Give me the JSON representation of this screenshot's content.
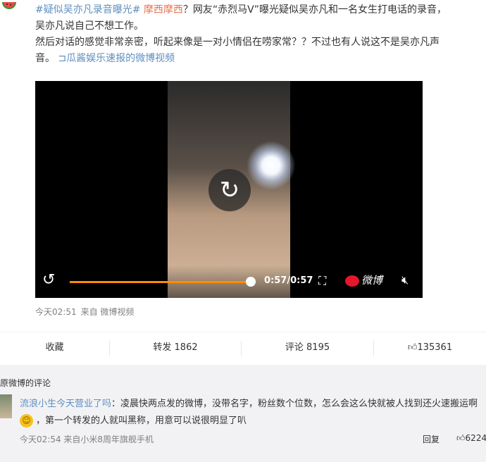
{
  "post": {
    "line1_hashtag": "#疑似吴亦凡录音曝光#",
    "line1_user": "摩西摩西",
    "line1_rest": "？网友“赤烈马V”曝光疑似吴亦凡和一名女生打电话的录音，",
    "line2": "吴亦凡说自己不想工作。",
    "line3": "然后对话的感觉非常亲密，听起来像是一对小情侣在唠家常？？不过也有人说这不是吴亦凡声",
    "line4_start": "音。",
    "line4_link": "瓜酱娱乐速报的微博视频"
  },
  "video": {
    "time": "0:57/0:57",
    "brand": "微博",
    "progress": 1.0
  },
  "meta": {
    "time": "今天02:51",
    "source": "来自 微博视频"
  },
  "actions": {
    "favorite": "收藏",
    "repost": "转发 1862",
    "comment": "评论 8195",
    "like": "135361"
  },
  "comments": {
    "title": "原微博的评论",
    "items": [
      {
        "user": "流浪小生今天营业了吗",
        "text1": "：凌晨快两点发的微博，没带名字，粉丝数个位数，怎么会这么快就被人找到还火速搬运啊",
        "text2": "，第一个转发的人就叫黑称，用意可以说很明显了叭",
        "time": "今天02:54",
        "source": "来自小米8周年旗舰手机",
        "reply": "回复",
        "likes": "6224"
      }
    ]
  },
  "colors": {
    "hashtag": "#eb7350",
    "link": "#5f8fbf",
    "progress": "#ff8c00",
    "comment_bg": "#f2f2f5"
  }
}
